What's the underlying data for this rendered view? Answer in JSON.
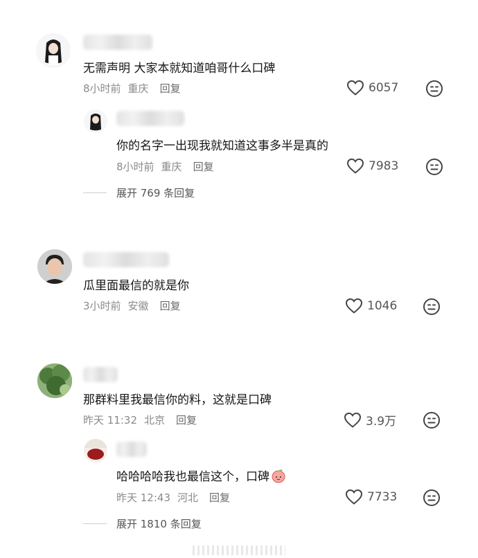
{
  "comments": [
    {
      "text": "无需声明 大家本就知道咱哥什么口碑",
      "time": "8小时前",
      "location": "重庆",
      "reply_label": "回复",
      "likes": "6057",
      "reply": {
        "text": "你的名字一出现我就知道这事多半是真的",
        "time": "8小时前",
        "location": "重庆",
        "reply_label": "回复",
        "likes": "7983"
      },
      "expand_label": "展开 769 条回复"
    },
    {
      "text": "瓜里面最信的就是你",
      "time": "3小时前",
      "location": "安徽",
      "reply_label": "回复",
      "likes": "1046"
    },
    {
      "text": "那群料里我最信你的料，这就是口碑",
      "time": "昨天 11:32",
      "location": "北京",
      "reply_label": "回复",
      "likes": "3.9万",
      "reply": {
        "text": "哈哈哈哈我也最信这个，口碑",
        "time": "昨天 12:43",
        "location": "河北",
        "reply_label": "回复",
        "likes": "7733"
      },
      "expand_label": "展开 1810 条回复"
    }
  ],
  "icons": {
    "like": "heart-outline-icon",
    "dislike": "meh-face-icon",
    "peach_emoji": "peach-emoji-icon"
  },
  "colors": {
    "meta": "#8a8a8a",
    "text": "#161616",
    "icon": "#444444"
  }
}
